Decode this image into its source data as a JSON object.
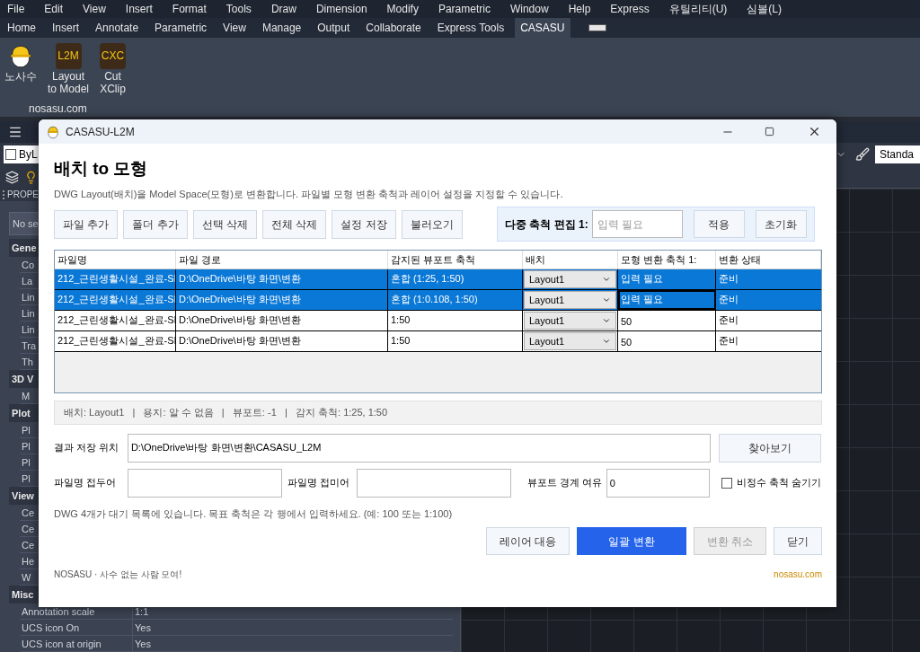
{
  "menu_bar": [
    "File",
    "Edit",
    "View",
    "Insert",
    "Format",
    "Tools",
    "Draw",
    "Dimension",
    "Modify",
    "Parametric",
    "Window",
    "Help",
    "Express",
    "유틸리티(U)",
    "심볼(L)"
  ],
  "ribbon_tabs": [
    {
      "label": "Home",
      "selected": false
    },
    {
      "label": "Insert",
      "selected": false
    },
    {
      "label": "Annotate",
      "selected": false
    },
    {
      "label": "Parametric",
      "selected": false
    },
    {
      "label": "View",
      "selected": false
    },
    {
      "label": "Manage",
      "selected": false
    },
    {
      "label": "Output",
      "selected": false
    },
    {
      "label": "Collaborate",
      "selected": false
    },
    {
      "label": "Express Tools",
      "selected": false
    },
    {
      "label": "CASASU",
      "selected": true
    }
  ],
  "ribbon_buttons": [
    {
      "kind": "mascot",
      "lines": [
        "노사수"
      ]
    },
    {
      "kind": "badge",
      "badge": "L2M",
      "lines": [
        "Layout",
        "to Model"
      ]
    },
    {
      "kind": "badge",
      "badge": "CXC",
      "lines": [
        "Cut",
        "XClip"
      ]
    }
  ],
  "ribbon_panel_title": "nosasu.com",
  "layer_control": "ByL",
  "text_style": "Standa",
  "properties": {
    "title": "PROPE",
    "selection": "No se",
    "sections": [
      {
        "title": "Gene",
        "rows": [
          {
            "name": "Co"
          },
          {
            "name": "La"
          },
          {
            "name": "Lin"
          },
          {
            "name": "Lin"
          },
          {
            "name": "Lin"
          },
          {
            "name": "Tra"
          },
          {
            "name": "Th"
          }
        ]
      },
      {
        "title": "3D V",
        "rows": [
          {
            "name": "M"
          }
        ]
      },
      {
        "title": "Plot",
        "rows": [
          {
            "name": "Pl"
          },
          {
            "name": "Pl"
          },
          {
            "name": "Pl"
          },
          {
            "name": "Pl"
          }
        ]
      },
      {
        "title": "View",
        "rows": [
          {
            "name": "Ce"
          },
          {
            "name": "Ce"
          },
          {
            "name": "Ce"
          },
          {
            "name": "He"
          },
          {
            "name": "W"
          }
        ]
      },
      {
        "title": "Misc",
        "rows": [
          {
            "name": "Annotation scale",
            "value": "1:1"
          },
          {
            "name": "UCS icon On",
            "value": "Yes"
          },
          {
            "name": "UCS icon at origin",
            "value": "Yes"
          }
        ]
      }
    ]
  },
  "dialog": {
    "title": "CASASU-L2M",
    "heading": "배치 to 모형",
    "description": "DWG Layout(배치)을 Model Space(모형)로 변환합니다. 파일별 모형 변환 축척과 레이어 설정을 지정할 수 있습니다.",
    "toolbar_buttons": [
      "파일 추가",
      "폴더 추가",
      "선택 삭제",
      "전체 삭제",
      "설정 저장",
      "불러오기"
    ],
    "multi_scale": {
      "label": "다중 축척 편집  1:",
      "placeholder": "입력 필요",
      "buttons": [
        "적용",
        "초기화"
      ]
    },
    "table": {
      "columns": [
        "파일명",
        "파일 경로",
        "감지된 뷰포트 축척",
        "배치",
        "모형 변환 축척 1:",
        "변환 상태"
      ],
      "rows": [
        {
          "selected": true,
          "file": "212_근린생활시설_완료-SI",
          "path": "D:\\OneDrive\\바탕 화면\\변환",
          "detected": "혼합 (1:25, 1:50)",
          "layout": "Layout1",
          "target": "입력 필요",
          "focused": false,
          "status": "준비"
        },
        {
          "selected": true,
          "file": "212_근린생활시설_완료-SI",
          "path": "D:\\OneDrive\\바탕 화면\\변환",
          "detected": "혼합 (1:0.108, 1:50)",
          "layout": "Layout1",
          "target": "입력 필요",
          "focused": true,
          "status": "준비"
        },
        {
          "selected": false,
          "file": "212_근린생활시설_완료-SI",
          "path": "D:\\OneDrive\\바탕 화면\\변환",
          "detected": "1:50",
          "layout": "Layout1",
          "target": "50",
          "focused": false,
          "status": "준비"
        },
        {
          "selected": false,
          "file": "212_근린생활시설_완료-SI",
          "path": "D:\\OneDrive\\바탕 화면\\변환",
          "detected": "1:50",
          "layout": "Layout1",
          "target": "50",
          "focused": false,
          "status": "준비"
        }
      ]
    },
    "status_line": "배치: Layout1   |   용지: 알 수 없음   |   뷰포트: -1   |   감지 축척: 1:25, 1:50",
    "output": {
      "label": "결과 저장 위치",
      "value": "D:\\OneDrive\\바탕 화면\\변환\\CASASU_L2M",
      "button": "찾아보기"
    },
    "prefix": {
      "label": "파일명 접두어"
    },
    "suffix": {
      "label": "파일명 접미어"
    },
    "margin": {
      "label": "뷰포트 경계 여유",
      "value": "0"
    },
    "hide_non_integer": {
      "label": "비정수 축척 숨기기",
      "checked": false
    },
    "info": "DWG 4개가 대기 목록에 있습니다. 목표 축척은 각 행에서 입력하세요. (예: 100 또는 1:100)",
    "actions": [
      {
        "label": "레이어 대응",
        "kind": "normal"
      },
      {
        "label": "일괄 변환",
        "kind": "primary"
      },
      {
        "label": "변환 취소",
        "kind": "disabled"
      },
      {
        "label": "닫기",
        "kind": "normal"
      }
    ],
    "footer_left": "NOSASU · 사수 없는 사람 모여!",
    "footer_right": "nosasu.com"
  }
}
